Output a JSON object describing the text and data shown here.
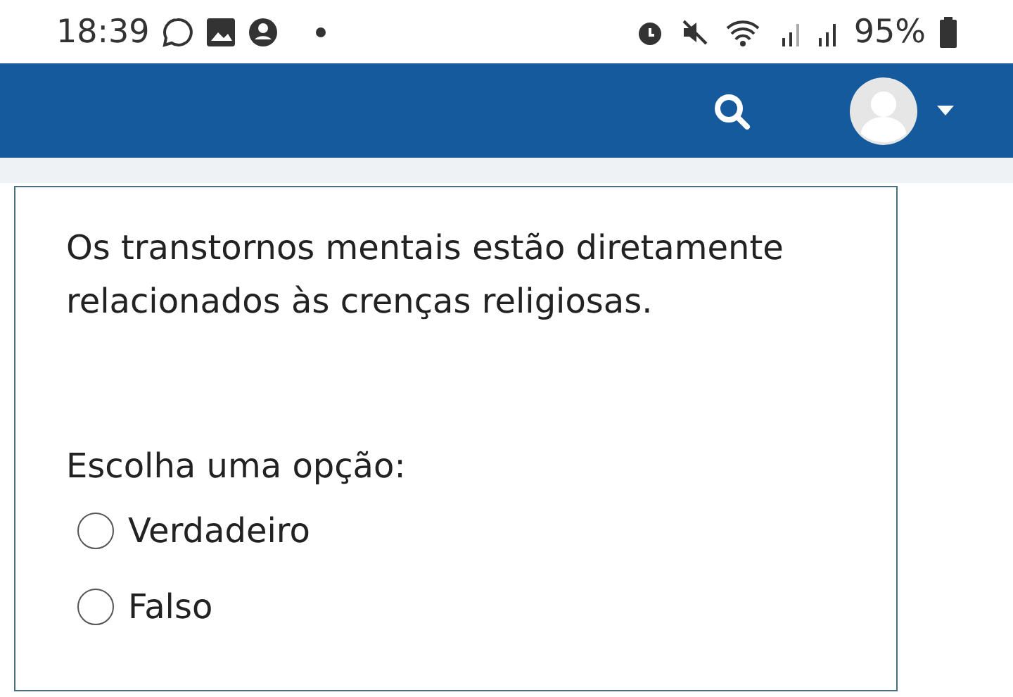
{
  "status_bar": {
    "time": "18:39",
    "battery": "95%"
  },
  "question": {
    "text": "Os transtornos mentais estão diretamente relacionados às crenças religiosas.",
    "prompt": "Escolha uma opção:",
    "options": [
      {
        "label": "Verdadeiro",
        "selected": false
      },
      {
        "label": "Falso",
        "selected": false
      }
    ]
  }
}
